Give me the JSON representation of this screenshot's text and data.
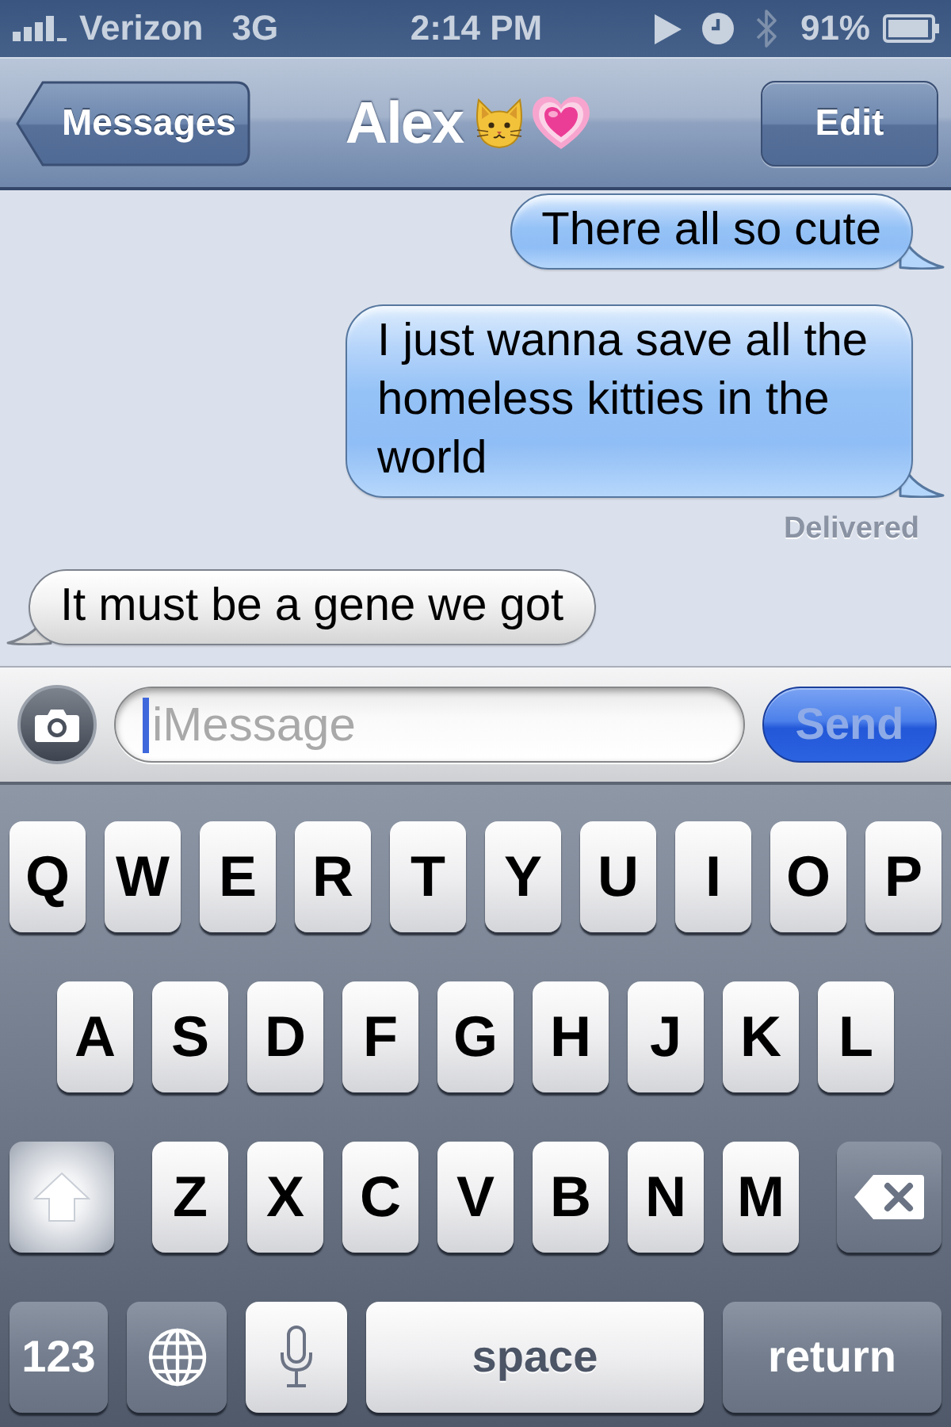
{
  "status_bar": {
    "carrier": "Verizon",
    "network": "3G",
    "time": "2:14 PM",
    "battery": "91%"
  },
  "nav_bar": {
    "back_button": "Messages",
    "title": "Alex",
    "edit_button": "Edit"
  },
  "messages": [
    {
      "kind": "sent",
      "text": "There all so cute"
    },
    {
      "kind": "sent",
      "text": "I just wanna save all the homeless kitties in the world"
    },
    {
      "kind": "status",
      "text": "Delivered"
    },
    {
      "kind": "received",
      "text": "It must be a gene we got"
    }
  ],
  "composer": {
    "placeholder": "iMessage",
    "send_button": {
      "label": "Send",
      "disabled": true
    }
  },
  "keyboard": {
    "rows": [
      {
        "keys": [
          {
            "kind": "letter",
            "label": "Q"
          },
          {
            "kind": "letter",
            "label": "W"
          },
          {
            "kind": "letter",
            "label": "E"
          },
          {
            "kind": "letter",
            "label": "R"
          },
          {
            "kind": "letter",
            "label": "T"
          },
          {
            "kind": "letter",
            "label": "Y"
          },
          {
            "kind": "letter",
            "label": "U"
          },
          {
            "kind": "letter",
            "label": "I"
          },
          {
            "kind": "letter",
            "label": "O"
          },
          {
            "kind": "letter",
            "label": "P"
          }
        ]
      },
      {
        "keys": [
          {
            "kind": "letter",
            "label": "A"
          },
          {
            "kind": "letter",
            "label": "S"
          },
          {
            "kind": "letter",
            "label": "D"
          },
          {
            "kind": "letter",
            "label": "F"
          },
          {
            "kind": "letter",
            "label": "G"
          },
          {
            "kind": "letter",
            "label": "H"
          },
          {
            "kind": "letter",
            "label": "J"
          },
          {
            "kind": "letter",
            "label": "K"
          },
          {
            "kind": "letter",
            "label": "L"
          }
        ]
      },
      {
        "keys": [
          {
            "kind": "shift",
            "on": true
          },
          {
            "kind": "letter",
            "label": "Z"
          },
          {
            "kind": "letter",
            "label": "X"
          },
          {
            "kind": "letter",
            "label": "C"
          },
          {
            "kind": "letter",
            "label": "V"
          },
          {
            "kind": "letter",
            "label": "B"
          },
          {
            "kind": "letter",
            "label": "N"
          },
          {
            "kind": "letter",
            "label": "M"
          },
          {
            "kind": "delete"
          }
        ]
      },
      {
        "keys": [
          {
            "kind": "numbers",
            "label": "123"
          },
          {
            "kind": "globe"
          },
          {
            "kind": "dictation"
          },
          {
            "kind": "space",
            "label": "space"
          },
          {
            "kind": "return",
            "label": "return"
          }
        ]
      }
    ]
  }
}
